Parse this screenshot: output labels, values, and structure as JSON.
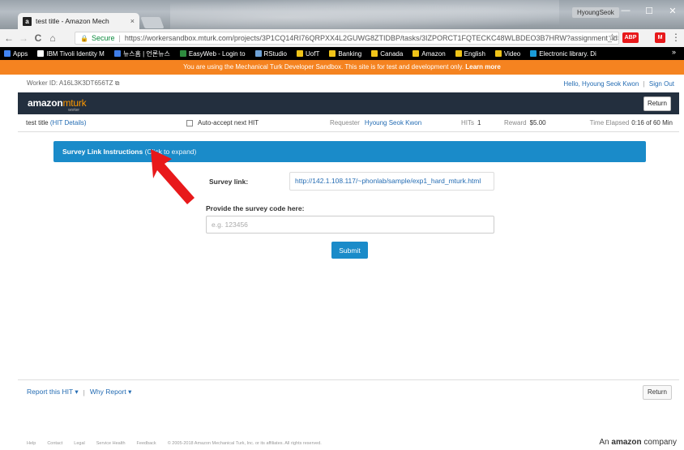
{
  "browser": {
    "tab_title": "test title - Amazon Mech",
    "tab_favicon": "a",
    "tab_close": "×",
    "profile_name": "HyoungSeok",
    "window_buttons": [
      "—",
      "☐",
      "✕"
    ],
    "nav": {
      "back": "←",
      "forward": "→",
      "reload": "C",
      "home": "⌂"
    },
    "lock_icon": "🔒",
    "secure_label": "Secure",
    "url": "https://workersandbox.mturk.com/projects/3P1CQ14RI76QRPXX4L2GUWG8ZTIDBP/tasks/3IZPORCT1FQTECKC48WLBDEO3B7HRW?assignment_id=3...",
    "star": "☆",
    "ext_red_label": "ABP",
    "ext_red_label2": "M",
    "menu": "⋮",
    "bookmarks": [
      {
        "label": "Apps",
        "color": "#4285f4"
      },
      {
        "label": "IBM Tivoli Identity M",
        "color": "#ffffff"
      },
      {
        "label": "뉴스홈 | 언론뉴스",
        "color": "#3f7ee8"
      },
      {
        "label": "EasyWeb - Login to",
        "color": "#2e8b3e"
      },
      {
        "label": "RStudio",
        "color": "#6fa3d8"
      },
      {
        "label": "UofT",
        "color": "#f0c419"
      },
      {
        "label": "Banking",
        "color": "#f0c419"
      },
      {
        "label": "Canada",
        "color": "#f0c419"
      },
      {
        "label": "Amazon",
        "color": "#f0c419"
      },
      {
        "label": "English",
        "color": "#f0c419"
      },
      {
        "label": "Video",
        "color": "#f0c419"
      },
      {
        "label": "Electronic library. Di",
        "color": "#1a9bd7"
      }
    ],
    "bookmarks_more": "»"
  },
  "sandbox_banner": {
    "text": "You are using the Mechanical Turk Developer Sandbox. This site is for test and development only.",
    "link": "Learn more"
  },
  "worker_bar": {
    "worker_id": "Worker ID: A16L3K3DT656TZ",
    "hello": "Hello,",
    "user_name": "Hyoung Seok Kwon",
    "sep": "|",
    "sign_out": "Sign Out"
  },
  "mturk_header": {
    "logo_amazon": "amazon",
    "logo_mturk": "mturk",
    "logo_worker": "worker",
    "return_label": "Return"
  },
  "hit_info": {
    "title": "test title",
    "hit_details": "(HIT Details)",
    "auto_accept": "Auto-accept next HIT",
    "requester_label": "Requester",
    "requester_name": "Hyoung Seok Kwon",
    "hits_label": "HITs",
    "hits_value": "1",
    "reward_label": "Reward",
    "reward_value": "$5.00",
    "elapsed_label": "Time Elapsed",
    "elapsed_value": "0:16 of 60 Min"
  },
  "task": {
    "instructions_title": "Survey Link Instructions",
    "instructions_expand": "(Click to expand)",
    "survey_link_label": "Survey link:",
    "survey_link": "http://142.1.108.117/~phonlab/sample/exp1_hard_mturk.html",
    "code_label": "Provide the survey code here:",
    "code_placeholder": "e.g. 123456",
    "code_value": "",
    "submit_label": "Submit"
  },
  "footer": {
    "report_hit": "Report this HIT ▾",
    "pipe": "|",
    "why_report": "Why Report ▾",
    "return_label": "Return"
  },
  "bottom_bar": {
    "links": [
      "Help",
      "Contact",
      "Legal",
      "Service Health",
      "Feedback",
      "© 2005-2018 Amazon Mechanical Turk, Inc. or its affiliates. All rights reserved."
    ],
    "brand_prefix": "An",
    "brand_name": "amazon",
    "brand_suffix": "company"
  },
  "colors": {
    "sandbox_orange": "#f58320",
    "header_navy": "#232f3e",
    "accent_blue": "#1a8bc9",
    "link_blue": "#246cb3",
    "annotation_red": "#e8191b"
  }
}
